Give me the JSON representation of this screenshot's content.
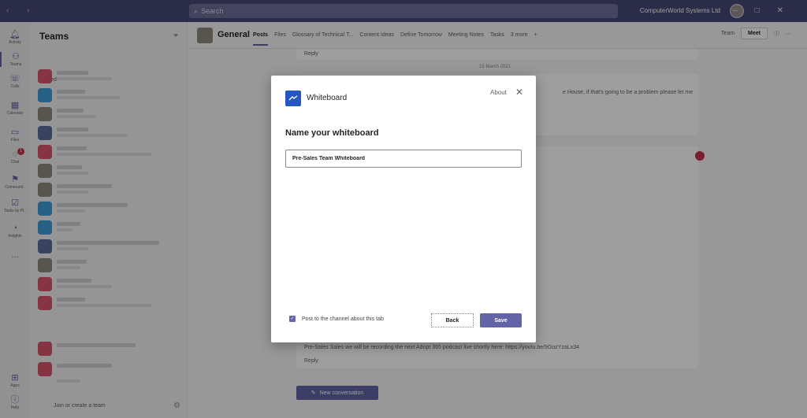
{
  "titlebar": {
    "search_placeholder": "Search",
    "org_name": "ComputerWorld Systems Ltd"
  },
  "rail": {
    "items": [
      {
        "label": "Activity",
        "icon": "bell-icon"
      },
      {
        "label": "Teams",
        "icon": "teams-icon"
      },
      {
        "label": "Calls",
        "icon": "phone-icon"
      },
      {
        "label": "Calendar",
        "icon": "calendar-icon"
      },
      {
        "label": "Files",
        "icon": "file-icon"
      },
      {
        "label": "Chat",
        "icon": "chat-icon"
      },
      {
        "label": "Communit..",
        "icon": "community-icon"
      },
      {
        "label": "Tasks by Pl..",
        "icon": "tasks-icon"
      },
      {
        "label": "Insights",
        "icon": "insights-icon"
      },
      {
        "label": "...",
        "icon": "more-icon"
      },
      {
        "label": "Apps",
        "icon": "apps-icon"
      },
      {
        "label": "Help",
        "icon": "help-icon"
      }
    ],
    "chat_badge": "1"
  },
  "teams_panel": {
    "title": "Teams",
    "pinned_label": "Pinned",
    "join_label": "Join or create a team"
  },
  "channel": {
    "name": "General",
    "tabs": [
      "Posts",
      "Files",
      "Glossary of Technical T...",
      "Content Ideas",
      "Define Tomorrow",
      "Meeting Notes",
      "Tasks",
      "3 more"
    ],
    "team_label": "Team",
    "meet_label": "Meet"
  },
  "conversation": {
    "reply_label": "Reply",
    "date_separator": "15 March 2021",
    "message_fragment": "e House, if that's going to be a problem please let me",
    "bottom_message": "Pre-Sales Sales we will be recording the next Adopt 365 podcast live shortly here: https://youtu.be/9GozYzaLx34",
    "new_conversation_label": "New conversation"
  },
  "dialog": {
    "app_name": "Whiteboard",
    "about_label": "About",
    "heading": "Name your whiteboard",
    "input_value": "Pre-Sales Team Whiteboard",
    "checkbox_label": "Post to the channel about this tab",
    "checkbox_checked": true,
    "back_label": "Back",
    "save_label": "Save"
  },
  "colors": {
    "titlebar": "#464775",
    "accent": "#6264a7",
    "whiteboard_logo": "#2557c4",
    "alert": "#c4314b"
  }
}
